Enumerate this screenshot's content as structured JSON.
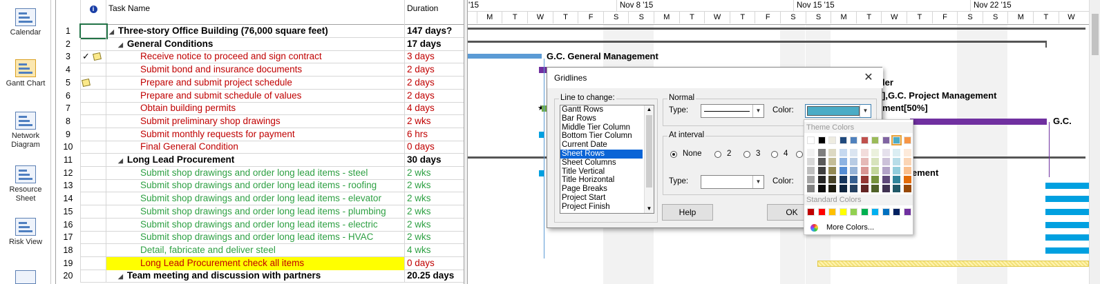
{
  "viewbar": {
    "items": [
      {
        "label": "Calendar",
        "icon": "calendar-icon"
      },
      {
        "label": "Gantt Chart",
        "icon": "gantt-chart-icon"
      },
      {
        "label": "Network\nDiagram",
        "icon": "network-diagram-icon"
      },
      {
        "label": "Resource\nSheet",
        "icon": "resource-sheet-icon"
      },
      {
        "label": "Risk View",
        "icon": "risk-view-icon"
      }
    ]
  },
  "sheet": {
    "header": {
      "info_icon": "info-icon",
      "name": "Task Name",
      "duration": "Duration"
    },
    "rows": [
      {
        "id": "1",
        "name": "Three-story Office Building (76,000 square feet)",
        "duration": "147 days?",
        "level": 0,
        "summary": true,
        "color": "#000000"
      },
      {
        "id": "2",
        "name": "General Conditions",
        "duration": "17 days",
        "level": 1,
        "summary": true,
        "color": "#000000"
      },
      {
        "id": "3",
        "name": "Receive notice to proceed and sign contract",
        "duration": "3 days",
        "level": 2,
        "color": "#c00000",
        "indicators": [
          "checkmark-icon",
          "note-icon"
        ]
      },
      {
        "id": "4",
        "name": "Submit bond and insurance documents",
        "duration": "2 days",
        "level": 2,
        "color": "#c00000"
      },
      {
        "id": "5",
        "name": "Prepare and submit project schedule",
        "duration": "2 days",
        "level": 2,
        "color": "#c00000",
        "indicators": [
          "note-icon"
        ]
      },
      {
        "id": "6",
        "name": "Prepare and submit schedule of values",
        "duration": "2 days",
        "level": 2,
        "color": "#c00000"
      },
      {
        "id": "7",
        "name": "Obtain building permits",
        "duration": "4 days",
        "level": 2,
        "color": "#c00000"
      },
      {
        "id": "8",
        "name": "Submit preliminary shop drawings",
        "duration": "2 wks",
        "level": 2,
        "color": "#c00000"
      },
      {
        "id": "9",
        "name": "Submit monthly requests for payment",
        "duration": "6 hrs",
        "level": 2,
        "color": "#c00000"
      },
      {
        "id": "10",
        "name": "Final General Condition",
        "duration": "0 days",
        "level": 2,
        "color": "#c00000"
      },
      {
        "id": "11",
        "name": "Long Lead Procurement",
        "duration": "30 days",
        "level": 1,
        "summary": true,
        "color": "#000000"
      },
      {
        "id": "12",
        "name": "Submit shop drawings and order long lead items - steel",
        "duration": "2 wks",
        "level": 2,
        "color": "#2ea043"
      },
      {
        "id": "13",
        "name": "Submit shop drawings and order long lead items - roofing",
        "duration": "2 wks",
        "level": 2,
        "color": "#2ea043"
      },
      {
        "id": "14",
        "name": "Submit shop drawings and order long lead items - elevator",
        "duration": "2 wks",
        "level": 2,
        "color": "#2ea043"
      },
      {
        "id": "15",
        "name": "Submit shop drawings and order long lead items - plumbing",
        "duration": "2 wks",
        "level": 2,
        "color": "#2ea043"
      },
      {
        "id": "16",
        "name": "Submit shop drawings and order long lead items - electric",
        "duration": "2 wks",
        "level": 2,
        "color": "#2ea043"
      },
      {
        "id": "17",
        "name": "Submit shop drawings and order long lead items - HVAC",
        "duration": "2 wks",
        "level": 2,
        "color": "#2ea043"
      },
      {
        "id": "18",
        "name": "Detail, fabricate and deliver steel",
        "duration": "4 wks",
        "level": 2,
        "color": "#2ea043"
      },
      {
        "id": "19",
        "name": "Long Lead Procurement check all items",
        "duration": "0 days",
        "level": 2,
        "color": "#c00000",
        "highlight": "#ffff00"
      },
      {
        "id": "20",
        "name": "Team meeting and discussion with partners",
        "duration": "20.25 days",
        "level": 1,
        "summary": true,
        "color": "#000000"
      }
    ]
  },
  "timeline": {
    "weeks": [
      "'15",
      "Nov 8 '15",
      "Nov 15 '15",
      "Nov 22 '15"
    ],
    "days": [
      "M",
      "T",
      "W",
      "T",
      "F",
      "S",
      "S",
      "M",
      "T",
      "W",
      "T",
      "F",
      "S",
      "S",
      "M",
      "T",
      "W",
      "T",
      "F",
      "S",
      "S",
      "M",
      "T",
      "W"
    ]
  },
  "gantt_labels": {
    "gc_general": "G.C. General Management",
    "row6_suffix": "],G.C. Project Management",
    "row7_suffix": "ment[50%]",
    "row4_end": "ler",
    "row9_right": "G.C.",
    "row12_suffix": "ement"
  },
  "dialog": {
    "title": "Gridlines",
    "close": "✕",
    "line_to_change_label": "Line to change:",
    "list": [
      "Gantt Rows",
      "Bar Rows",
      "Middle Tier Column",
      "Bottom Tier Column",
      "Current Date",
      "Sheet Rows",
      "Sheet Columns",
      "Title Vertical",
      "Title Horizontal",
      "Page Breaks",
      "Project Start",
      "Project Finish"
    ],
    "selected_index": 5,
    "normal_label": "Normal",
    "type_label": "Type:",
    "color_label": "Color:",
    "color_value": "#4bacc6",
    "at_interval_label": "At interval",
    "interval_options": [
      "None",
      "2",
      "3",
      "4"
    ],
    "interval_selected": "None",
    "interval_type_label": "Type:",
    "interval_color_label": "Color:",
    "help_button": "Help",
    "ok_button": "OK"
  },
  "palette": {
    "theme_header": "Theme Colors",
    "standard_header": "Standard Colors",
    "more_colors": "More Colors...",
    "theme_top": [
      "#ffffff",
      "#000000",
      "#eeece1",
      "#1f497d",
      "#4f81bd",
      "#c0504d",
      "#9bbb59",
      "#8064a2",
      "#4bacc6",
      "#f79646"
    ],
    "theme_shades": [
      [
        "#f2f2f2",
        "#7f7f7f",
        "#ddd9c3",
        "#c6d9f0",
        "#dbe5f1",
        "#f2dcdb",
        "#ebf1dd",
        "#e5e0ec",
        "#dbeef3",
        "#fdeada"
      ],
      [
        "#d8d8d8",
        "#595959",
        "#c4bd97",
        "#8db3e2",
        "#b8cce4",
        "#e5b9b7",
        "#d7e3bc",
        "#ccc1d9",
        "#b7dde8",
        "#fbd5b5"
      ],
      [
        "#bfbfbf",
        "#3f3f3f",
        "#938953",
        "#548dd4",
        "#95b3d7",
        "#d99694",
        "#c3d69b",
        "#b2a2c7",
        "#92cddc",
        "#fac08f"
      ],
      [
        "#a5a5a5",
        "#262626",
        "#494429",
        "#17365d",
        "#366092",
        "#953734",
        "#76923c",
        "#5f497a",
        "#31859b",
        "#e36c09"
      ],
      [
        "#7f7f7f",
        "#0c0c0c",
        "#1d1b10",
        "#0f243e",
        "#244061",
        "#632423",
        "#4f6128",
        "#3f3151",
        "#205867",
        "#974806"
      ]
    ],
    "standard": [
      "#c00000",
      "#ff0000",
      "#ffc000",
      "#ffff00",
      "#92d050",
      "#00b050",
      "#00b0f0",
      "#0070c0",
      "#002060",
      "#7030a0"
    ]
  }
}
